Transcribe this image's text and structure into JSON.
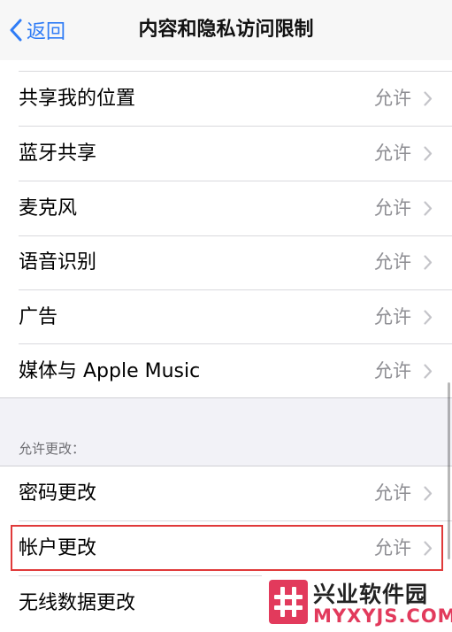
{
  "navbar": {
    "back_label": "返回",
    "title": "内容和隐私访问限制"
  },
  "group1": {
    "items": [
      {
        "label": "共享我的位置",
        "value": "允许"
      },
      {
        "label": "蓝牙共享",
        "value": "允许"
      },
      {
        "label": "麦克风",
        "value": "允许"
      },
      {
        "label": "语音识别",
        "value": "允许"
      },
      {
        "label": "广告",
        "value": "允许"
      },
      {
        "label": "媒体与 Apple Music",
        "value": "允许"
      }
    ]
  },
  "group2": {
    "header": "允许更改：",
    "items": [
      {
        "label": "密码更改",
        "value": "允许"
      },
      {
        "label": "帐户更改",
        "value": "允许"
      },
      {
        "label": "无线数据更改",
        "value": ""
      }
    ]
  },
  "watermark": {
    "name_cn": "兴业软件园",
    "name_en": "MYXYJS.COM"
  },
  "colors": {
    "accent": "#2f7cf6",
    "highlight": "#e03a3a",
    "watermark": "#e23a5c"
  }
}
